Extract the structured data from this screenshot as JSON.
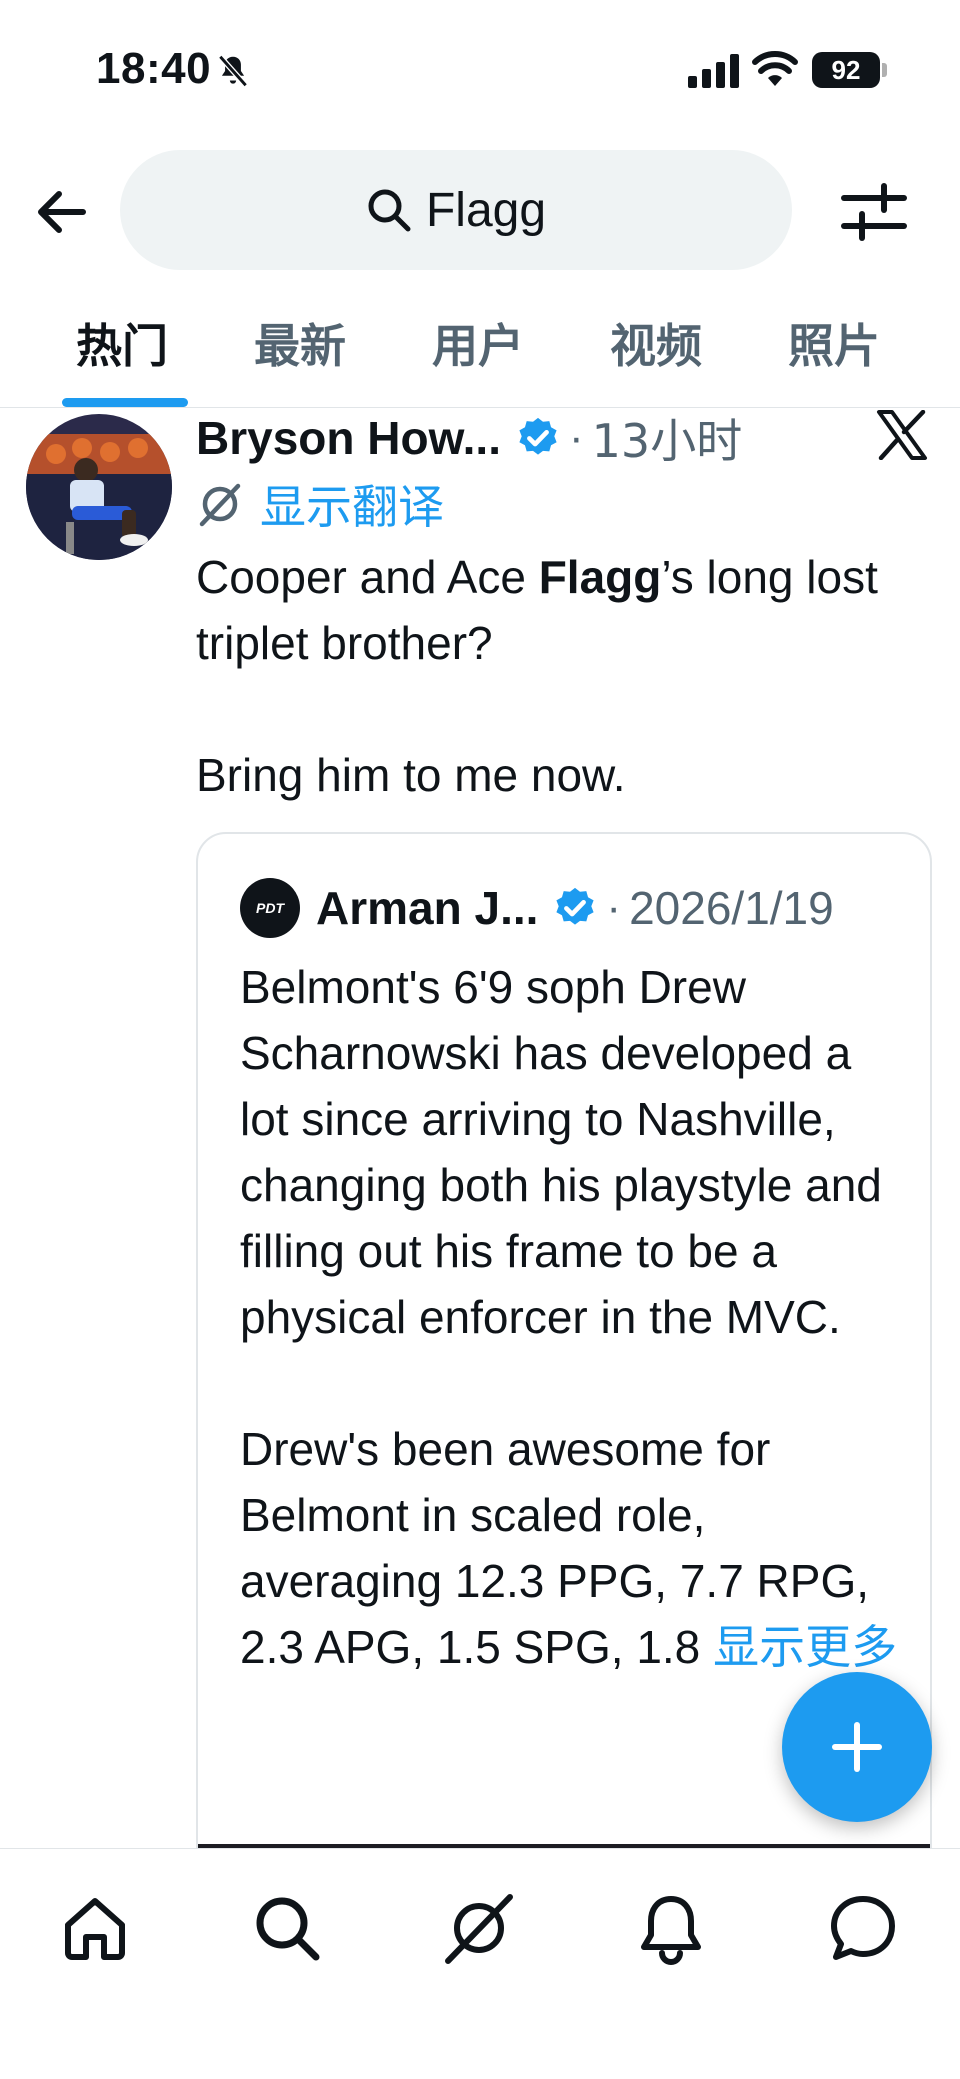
{
  "status_bar": {
    "time": "18:40",
    "battery": "92",
    "icons": [
      "bell-off-icon",
      "signal-icon",
      "wifi-icon",
      "battery-icon"
    ]
  },
  "header": {
    "search_value": "Flagg",
    "icons": [
      "back-arrow-icon",
      "search-icon",
      "filter-sliders-icon"
    ]
  },
  "tabs": [
    {
      "label": "热门",
      "active": true
    },
    {
      "label": "最新",
      "active": false
    },
    {
      "label": "用户",
      "active": false
    },
    {
      "label": "视频",
      "active": false
    },
    {
      "label": "照片",
      "active": false
    }
  ],
  "tweet": {
    "author": "Bryson How...",
    "dot": "·",
    "time": "13小时",
    "translate_label": "显示翻译",
    "text_before": "Cooper and Ace ",
    "text_highlight": "Flagg",
    "text_after": "’s long lost triplet brother?\n\nBring him to me now.",
    "quote": {
      "avatar_text": "PDT",
      "author": "Arman J...",
      "dot": "·",
      "time": "2026/1/19",
      "text": "Belmont's 6'9 soph Drew Scharnowski has developed a lot since arriving to Nashville, changing both his playstyle and filling out his frame to be a physical enforcer in the MVC.\n\nDrew's been awesome for Belmont in scaled role, averaging 12.3 PPG, 7.7 RPG, 2.3 APG, 1.5 SPG, 1.8 ",
      "show_more": "显示更多"
    }
  },
  "colors": {
    "accent": "#1d9bf0",
    "text": "#0f1419",
    "muted": "#536471",
    "search_bg": "#eff3f4"
  },
  "bottom_nav": [
    "home-icon",
    "search-icon",
    "grok-icon",
    "notifications-icon",
    "messages-icon"
  ]
}
